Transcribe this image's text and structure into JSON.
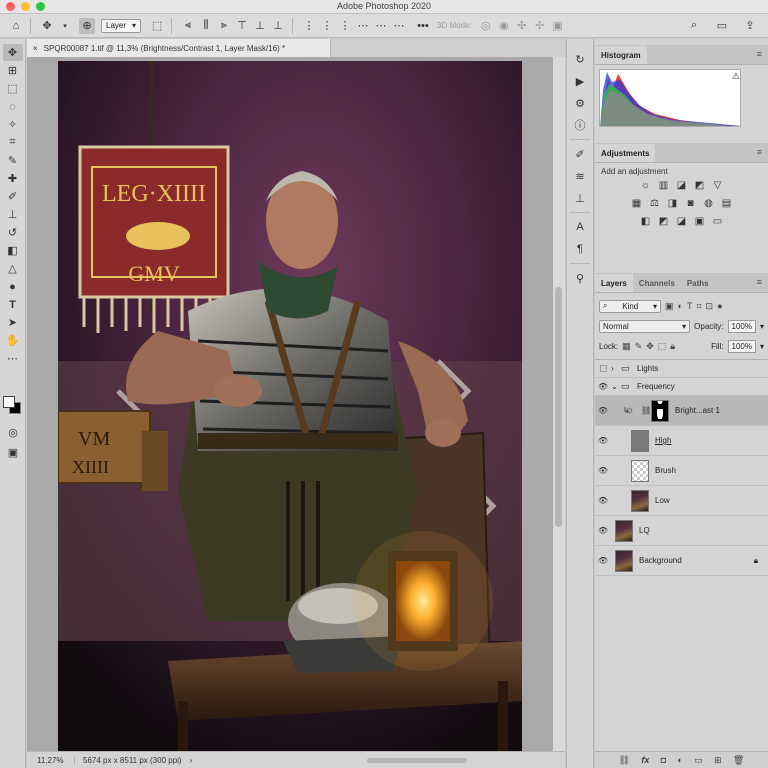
{
  "app": {
    "title": "Adobe Photoshop 2020"
  },
  "options_bar": {
    "layer_select": "Layer",
    "mode_3d": "3D Mode:",
    "more": "•••"
  },
  "document": {
    "tab_title": "SPQR00087 1.tif @ 11,3% (Brightness/Contrast 1, Layer Mask/16) *",
    "close": "×"
  },
  "status": {
    "zoom": "11,27%",
    "info": "5674 px x 8511 px (300 ppi)",
    "arrow": "›"
  },
  "banner": {
    "line1": "LEG·XIIII",
    "line2": "GMV"
  },
  "sign": {
    "line1": "VM",
    "line2": "XIIII"
  },
  "panels": {
    "histogram_tab": "Histogram",
    "adjustments_tab": "Adjustments",
    "adjustments_label": "Add an adjustment",
    "layers_tab": "Layers",
    "channels_tab": "Channels",
    "paths_tab": "Paths",
    "filter_kind": "Kind",
    "blend_mode": "Normal",
    "opacity_label": "Opacity:",
    "opacity_value": "100%",
    "lock_label": "Lock:",
    "fill_label": "Fill:",
    "fill_value": "100%"
  },
  "layers": [
    {
      "name": "Lights",
      "type": "group",
      "visible": false,
      "expanded": false
    },
    {
      "name": "Frequency",
      "type": "group",
      "visible": true,
      "expanded": true
    },
    {
      "name": "Bright...ast 1",
      "type": "adjustment",
      "visible": true,
      "selected": true
    },
    {
      "name": "High",
      "type": "pixel",
      "visible": true
    },
    {
      "name": "Brush",
      "type": "pixel",
      "visible": true
    },
    {
      "name": "Low",
      "type": "pixel",
      "visible": true
    },
    {
      "name": "LQ",
      "type": "pixel",
      "visible": true
    },
    {
      "name": "Background",
      "type": "pixel",
      "visible": true,
      "locked": true
    }
  ],
  "colors": {
    "panel_bg": "#d4d4d4",
    "selected_layer": "#b8b8b8",
    "banner_red": "#8b2a2a",
    "banner_gold": "#e7c25a",
    "lantern_glow": "#ffb02e"
  }
}
